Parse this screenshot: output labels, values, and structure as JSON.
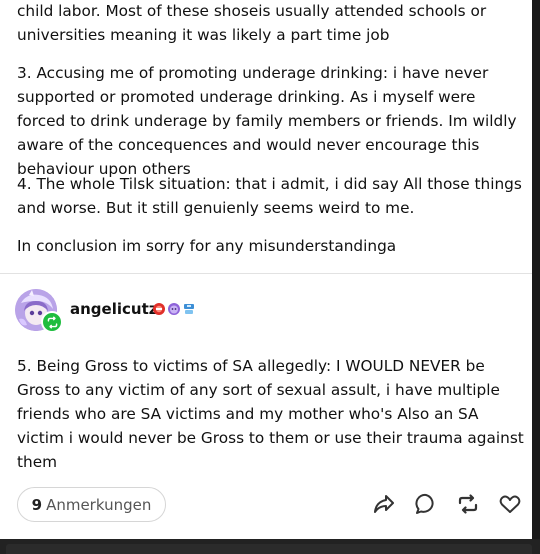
{
  "post": {
    "paragraphs": [
      "child labor. Most of these shoseis usually attended schools or universities meaning it was likely a part time job",
      "3. Accusing me of promoting underage drinking: i have never supported or promoted underage drinking. As i myself were forced to drink underage by family members or friends. Im wildly aware of the concequences and would never encourage this behaviour upon others",
      "4. The whole Tilsk situation: that i admit, i did say All those things and worse. But it still genuienly seems weird to me.",
      "In conclusion im sorry for any misunderstandinga"
    ],
    "reblog": {
      "username": "angelicutz",
      "badges": [
        "red-badge-icon",
        "purple-face-badge-icon",
        "blue-gem-badge-icon"
      ],
      "paragraphs": [
        "5. Being Gross to victims of SA allegedly: I WOULD NEVER be Gross to any victim  of any sort of sexual assult, i have multiple friends who are SA victims and my mother who's Also an SA victim i would never be Gross to them or use their trauma against them"
      ]
    },
    "footer": {
      "notes_count": "9",
      "notes_label": "Anmerkungen",
      "actions": [
        "share-icon",
        "reply-icon",
        "reblog-icon",
        "like-icon"
      ]
    }
  },
  "colors": {
    "reblog_green": "#1fbd3f",
    "text": "#111111",
    "divider": "#e2e2e2"
  }
}
